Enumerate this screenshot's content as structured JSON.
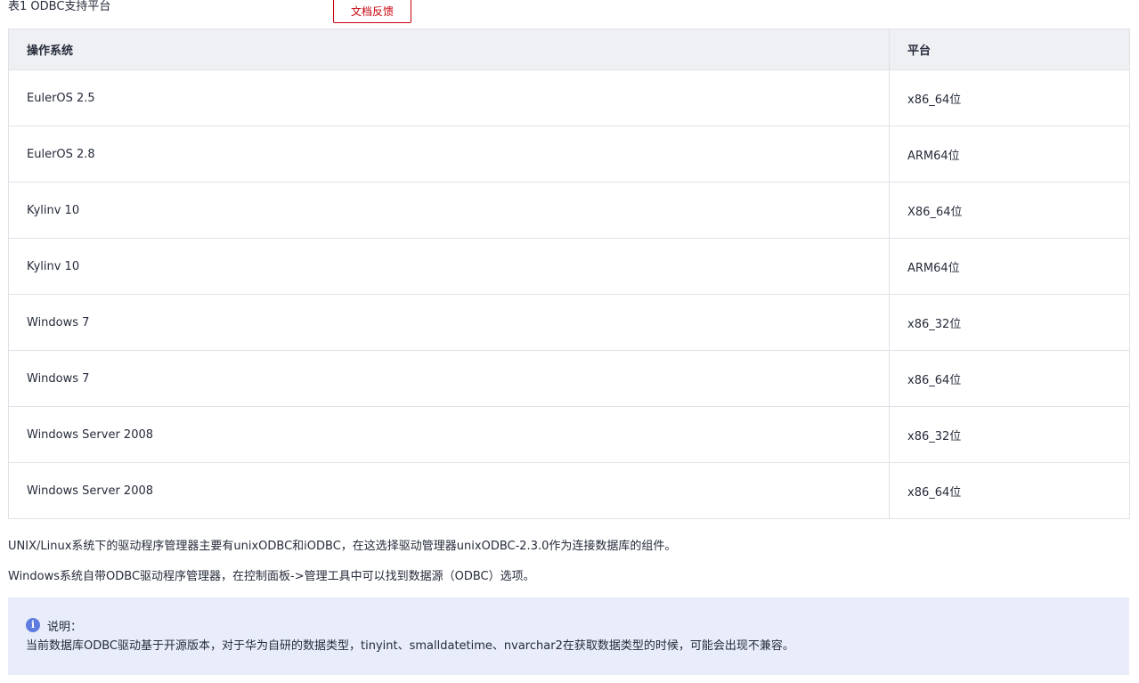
{
  "caption": "表1 ODBC支持平台",
  "feedback_button": "文档反馈",
  "table": {
    "headers": [
      "操作系统",
      "平台"
    ],
    "rows": [
      [
        "EulerOS 2.5",
        "x86_64位"
      ],
      [
        "EulerOS 2.8",
        "ARM64位"
      ],
      [
        "Kylinv 10",
        "X86_64位"
      ],
      [
        "Kylinv 10",
        "ARM64位"
      ],
      [
        "Windows 7",
        "x86_32位"
      ],
      [
        "Windows 7",
        "x86_64位"
      ],
      [
        "Windows Server 2008",
        "x86_32位"
      ],
      [
        "Windows Server 2008",
        "x86_64位"
      ]
    ]
  },
  "paragraphs": [
    "UNIX/Linux系统下的驱动程序管理器主要有unixODBC和iODBC，在这选择驱动管理器unixODBC-2.3.0作为连接数据库的组件。",
    "Windows系统自带ODBC驱动程序管理器，在控制面板->管理工具中可以找到数据源（ODBC）选项。"
  ],
  "note": {
    "icon": "info-icon",
    "title": "说明：",
    "body": "当前数据库ODBC驱动基于开源版本，对于华为自研的数据类型，tinyint、smalldatetime、nvarchar2在获取数据类型的时候，可能会出现不兼容。"
  },
  "colors": {
    "accent": "#c7000b",
    "header_bg": "#eff0f4",
    "note_bg": "#e8edf9",
    "info_icon": "#5e7ce0",
    "border": "#dfe1e6"
  }
}
